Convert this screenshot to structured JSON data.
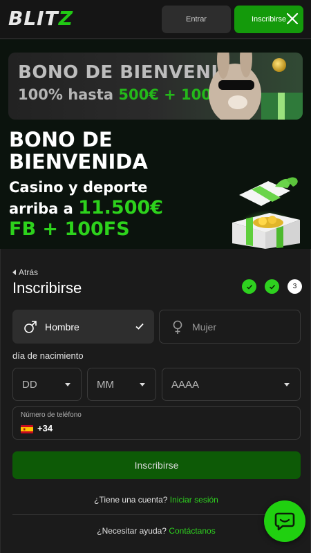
{
  "header": {
    "logo_text": "BLIT",
    "logo_accent": "Z",
    "login_label": "Entrar",
    "signup_label": "Inscribirse",
    "close_icon": "close-icon"
  },
  "promo": {
    "banner_title": "BONO DE BIENVENIDA",
    "banner_sub_prefix": "100% hasta ",
    "banner_sub_highlight": "500€ + 100FS",
    "title": "BONO DE BIENVENIDA",
    "subtitle_line1": "Casino y deporte",
    "subtitle_line2_prefix": "arriba a ",
    "subtitle_amount": "11.500€",
    "bonus_fs": "FB + 100FS"
  },
  "form": {
    "back_label": "Atrás",
    "title": "Inscribirse",
    "steps": [
      {
        "state": "done"
      },
      {
        "state": "done"
      },
      {
        "state": "current",
        "label": "3"
      }
    ],
    "gender_male": "Hombre",
    "gender_female": "Mujer",
    "dob_label": "día de nacimiento",
    "day_placeholder": "DD",
    "month_placeholder": "MM",
    "year_placeholder": "AAAA",
    "phone_label": "Número de teléfono",
    "phone_code": "+34",
    "submit_label": "Inscribirse",
    "have_account_text": "¿Tiene una cuenta?",
    "login_link": "Iniciar sesión",
    "help_text": "¿Necesitar ayuda?",
    "contact_link": "Contáctanos"
  },
  "colors": {
    "accent": "#2ed11f",
    "submit_bg": "#0d5a06",
    "header_signup_bg": "#149a0b"
  }
}
